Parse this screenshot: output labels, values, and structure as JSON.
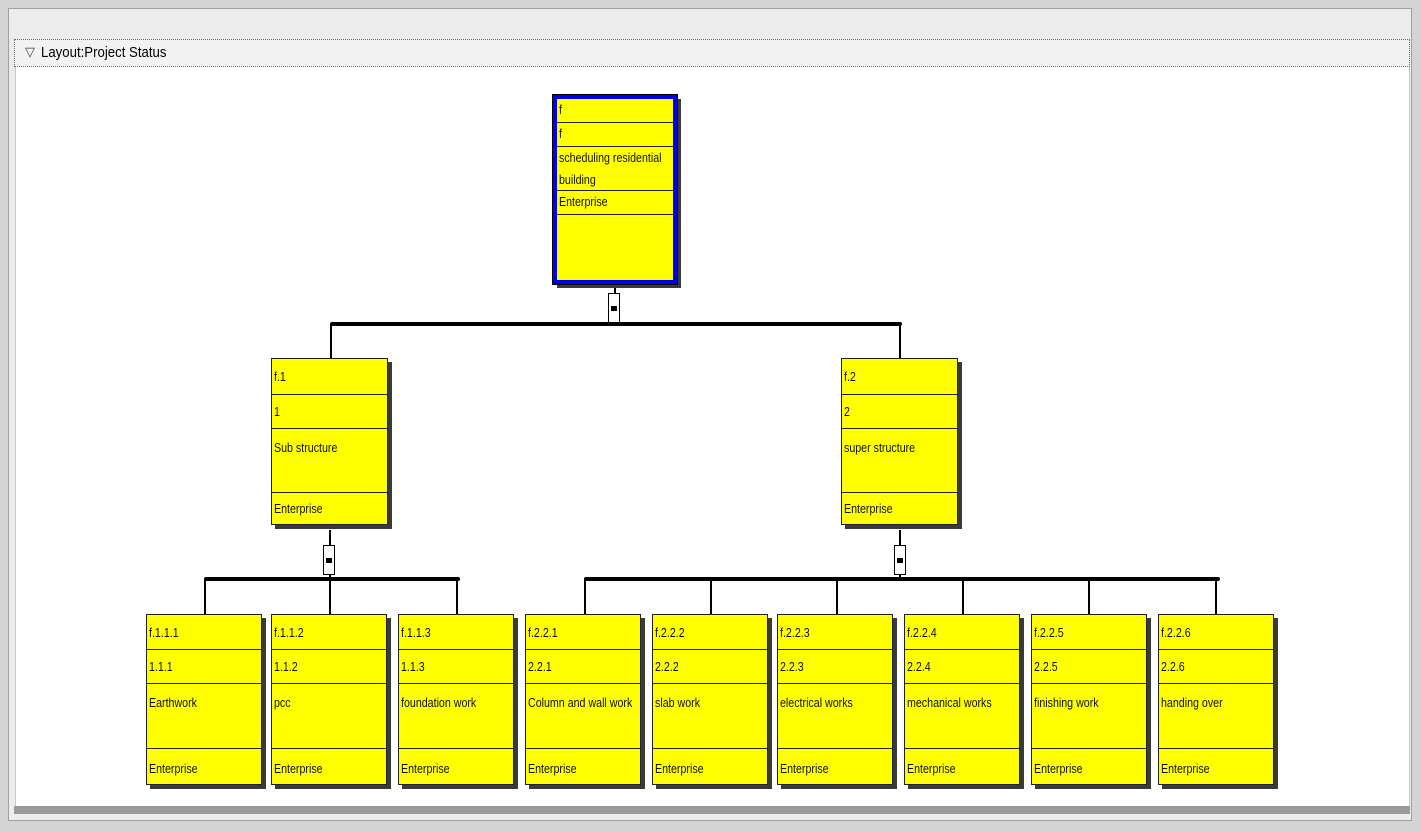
{
  "panel": {
    "toggle_icon": "triangle-down-icon",
    "title": "Layout:Project Status"
  },
  "root": {
    "code": "f",
    "short": "f",
    "name_line1": "scheduling residential",
    "name_line2": "building",
    "owner": "Enterprise"
  },
  "level1": [
    {
      "code": "f.1",
      "short": "1",
      "name": "Sub structure",
      "owner": "Enterprise"
    },
    {
      "code": "f.2",
      "short": "2",
      "name": "super structure",
      "owner": "Enterprise"
    }
  ],
  "level2": [
    {
      "code": "f.1.1.1",
      "short": "1.1.1",
      "name": "Earthwork",
      "owner": "Enterprise"
    },
    {
      "code": "f.1.1.2",
      "short": "1.1.2",
      "name": "pcc",
      "owner": "Enterprise"
    },
    {
      "code": "f.1.1.3",
      "short": "1.1.3",
      "name": "foundation work",
      "owner": "Enterprise"
    },
    {
      "code": "f.2.2.1",
      "short": "2.2.1",
      "name": "Column and wall work",
      "owner": "Enterprise"
    },
    {
      "code": "f.2.2.2",
      "short": "2.2.2",
      "name": "slab work",
      "owner": "Enterprise"
    },
    {
      "code": "f.2.2.3",
      "short": "2.2.3",
      "name": "electrical works",
      "owner": "Enterprise"
    },
    {
      "code": "f.2.2.4",
      "short": "2.2.4",
      "name": "mechanical works",
      "owner": "Enterprise"
    },
    {
      "code": "f.2.2.5",
      "short": "2.2.5",
      "name": "finishing work",
      "owner": "Enterprise"
    },
    {
      "code": "f.2.2.6",
      "short": "2.2.6",
      "name": "handing over",
      "owner": "Enterprise"
    }
  ],
  "colors": {
    "node_fill": "#ffff00",
    "selected_border": "#0000ee"
  }
}
